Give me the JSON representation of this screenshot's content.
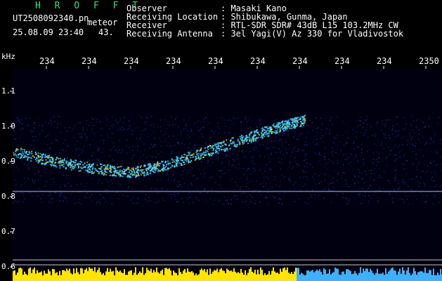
{
  "header": {
    "logo": "H R O F F T",
    "filename": "UT2508092340.pn",
    "mode": "meteor",
    "date_time": "25.08.09 23:40",
    "count": "43.",
    "fields": [
      {
        "label": "Observer",
        "value": ": Masaki Kano"
      },
      {
        "label": "Receiving Location",
        "value": ": Shibukawa, Gunma, Japan"
      },
      {
        "label": "Receiver",
        "value": ": RTL-SDR SDR# 43dB L15 103.2MHz CW"
      },
      {
        "label": "Receiving Antenna",
        "value": ": 3el Yagi(V) Az 330 for Vladivostok"
      }
    ]
  },
  "chart_data": {
    "type": "heatmap",
    "ylabel": "kHz",
    "x_ticks": [
      "234",
      "234",
      "234",
      "234",
      "234",
      "234",
      "234",
      "234",
      "234",
      "2350"
    ],
    "y_ticks": [
      "1.1",
      "1.0",
      "0.9",
      "0.8",
      "0.7",
      "0.6"
    ],
    "ylim": [
      0.6,
      1.1
    ],
    "traces": [
      {
        "name": "",
        "x": [
          0,
          0.1,
          0.2,
          0.28,
          0.35,
          0.45,
          0.55,
          0.62,
          0.68
        ],
        "y": [
          0.93,
          0.9,
          0.88,
          0.87,
          0.89,
          0.93,
          0.97,
          1.0,
          1.02
        ]
      }
    ],
    "baseline_khz": 0.815,
    "colors": {
      "background": "#000010",
      "noise": "#1f2f9a",
      "trace": "#43d7ff",
      "hot": "#ffd600",
      "baseline": "#9fb6ff"
    }
  }
}
